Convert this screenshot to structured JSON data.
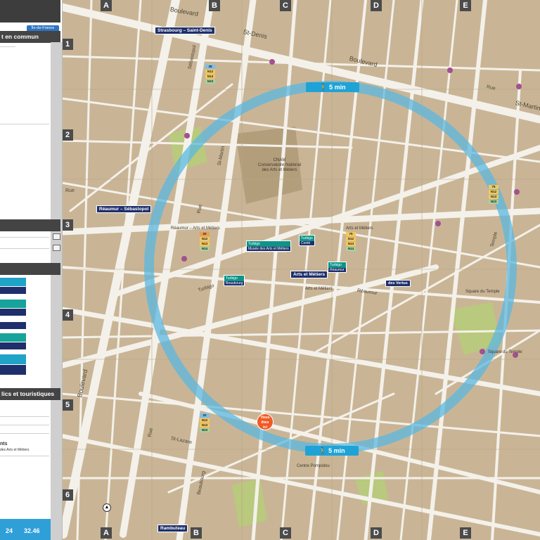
{
  "colors": {
    "block": "#c9b596",
    "street": "#f4f1ea",
    "walk_circle": "#5bb8e0",
    "walk_tag": "#1fa3d6",
    "station_navy": "#1e2f6b",
    "bus_green": "#0e9487",
    "metro_4": "#a3508f",
    "metro_3": "#9a993a",
    "metro_11": "#8a5e3c",
    "you_are_here": "#f15a24",
    "park": "#b9c97d"
  },
  "panel": {
    "heading_transport": "t en commun",
    "heading_tourist": "lics et touristiques",
    "heading_monuments": "nts",
    "monument_line": "des Arts et Métiers",
    "idf_badge": "Île-de-France",
    "price_1": "24",
    "price_2": "32.46"
  },
  "grid": {
    "columns": [
      "A",
      "B",
      "C",
      "D",
      "E"
    ],
    "rows": [
      "1",
      "2",
      "3",
      "4",
      "5",
      "6"
    ]
  },
  "walking": {
    "top_tag": "5 min",
    "bottom_tag": "5 min",
    "walk_icon": "pedestrian-icon"
  },
  "you_are_here": {
    "line1": "Vous",
    "line2": "êtes",
    "line3": "ici"
  },
  "stations": {
    "strasbourg": "Strasbourg – Saint-Denis",
    "reaumur": "Réaumur – Sébastopol",
    "arts_metiers": "Arts et Métiers",
    "rambuteau": "Rambuteau"
  },
  "bus_signs": {
    "turbigo": {
      "top": "Turbigo",
      "bottom": "Musée des Arts et Métiers"
    },
    "conte": {
      "top": "Turbigo",
      "bottom": "Conté"
    },
    "reaumur_stop": {
      "top": "Turbigo",
      "bottom": "Réaumur"
    },
    "beaubourg": {
      "top": "Turbigo",
      "bottom": "Beaubourg"
    },
    "vertus": "des Vertus"
  },
  "streets": {
    "boulevard_top": "Boulevard",
    "st_denis": "St-Denis",
    "boulevard_right": "Boulevard",
    "st_martin_top": "St-Martin",
    "sebastopol": "Sébastopol",
    "st_martin_mid": "St-Martin",
    "rue_mid": "Rue",
    "turbigo": "Turbigo",
    "reaumur": "Réaumur",
    "rue_left": "Rue",
    "boulevard_left": "Boulevard",
    "rue_bottom": "Rue",
    "beaubourg": "Beaubourg",
    "st_lazare": "St-Lazare",
    "rue_right": "Rue",
    "temple": "Temple"
  },
  "landmarks": {
    "cnam_1": "CNAM",
    "cnam_2": "Conservatoire National",
    "cnam_3": "des Arts et Métiers",
    "musee": "Musée des Arts et Métiers",
    "square_temple": "Square du Temple",
    "square_temple_2": "Square du Temple",
    "arts_metiers_poi": "Arts et Métiers",
    "arts_metiers_poi_2": "Arts et Métiers",
    "reaumur_arts": "Réaumur – Arts et Métiers",
    "centre_pompidou": "Centre Pompidou"
  },
  "bus_numbers": {
    "left_stack": [
      "38",
      "N12",
      "N14",
      "N23"
    ],
    "mid_stack": [
      "20",
      "N12",
      "N13",
      "N14"
    ],
    "arts_stack": [
      "75",
      "N12",
      "N13",
      "N14"
    ],
    "right_stack": [
      "75",
      "N12",
      "N13",
      "N23"
    ],
    "far_right": [
      "20",
      "N12",
      "N13",
      "N23"
    ]
  },
  "compass_icon": "compass-icon"
}
